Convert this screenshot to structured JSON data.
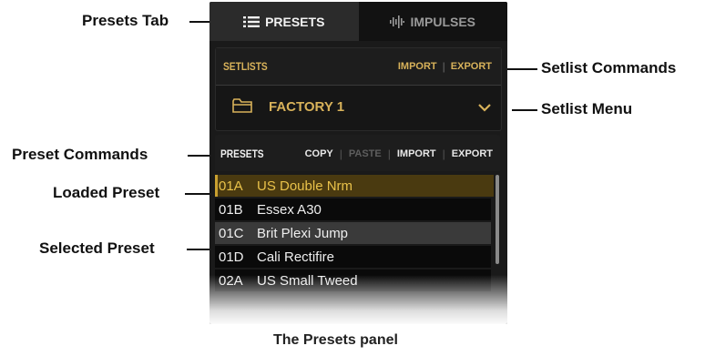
{
  "callouts": {
    "presets_tab": "Presets Tab",
    "setlist_commands": "Setlist Commands",
    "setlist_menu": "Setlist Menu",
    "preset_commands": "Preset Commands",
    "loaded_preset": "Loaded Preset",
    "selected_preset": "Selected Preset"
  },
  "tabs": [
    {
      "label": "PRESETS",
      "icon": "list-icon",
      "active": true
    },
    {
      "label": "IMPULSES",
      "icon": "impulse-icon",
      "active": false
    }
  ],
  "setlists": {
    "title": "SETLISTS",
    "import_label": "IMPORT",
    "separator": "|",
    "export_label": "EXPORT",
    "current": "FACTORY 1",
    "folder_icon": "folder-icon",
    "dropdown_icon": "chevron-down-icon"
  },
  "presets": {
    "title": "PRESETS",
    "copy_label": "COPY",
    "paste_label": "PASTE",
    "import_label": "IMPORT",
    "export_label": "EXPORT",
    "separator": "|",
    "items": [
      {
        "num": "01A",
        "name": "US Double Nrm",
        "state": "loaded"
      },
      {
        "num": "01B",
        "name": "Essex A30",
        "state": "normal"
      },
      {
        "num": "01C",
        "name": "Brit Plexi Jump",
        "state": "selected"
      },
      {
        "num": "01D",
        "name": "Cali Rectifire",
        "state": "normal"
      },
      {
        "num": "02A",
        "name": "US Small Tweed",
        "state": "normal"
      }
    ]
  },
  "caption": "The Presets panel",
  "colors": {
    "accent_gold": "#d8b25a",
    "loaded_bg": "#4a3a10",
    "selected_bg": "#3a3a3a"
  }
}
